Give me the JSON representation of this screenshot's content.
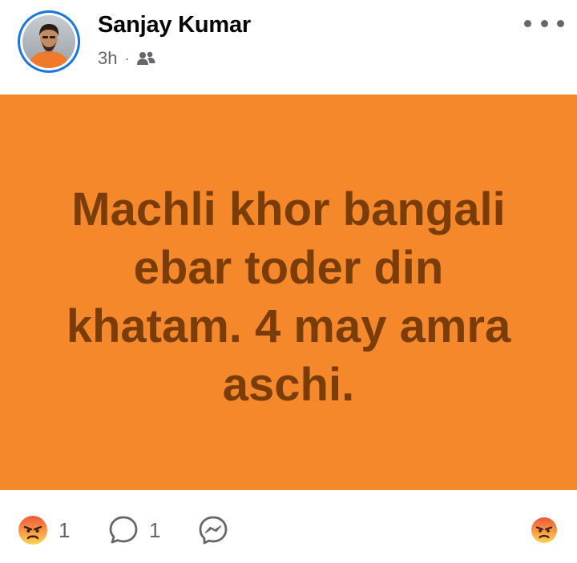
{
  "post": {
    "author": "Sanjay Kumar",
    "time": "3h",
    "separator": "·",
    "audience_icon": "friends-icon",
    "text": "Machli khor bangali ebar toder din khatam. 4 may amra aschi.",
    "background_color": "#f5882a",
    "text_color": "#7a3d08"
  },
  "footer": {
    "reaction": {
      "icon": "angry-reaction-icon",
      "count": "1"
    },
    "comments": {
      "icon": "comment-icon",
      "count": "1"
    },
    "share": {
      "icon": "messenger-icon"
    },
    "react_button": {
      "icon": "angry-reaction-icon"
    }
  },
  "colors": {
    "accent_ring": "#1b74e4",
    "muted": "#65676b",
    "angry_top": "#f0573a",
    "angry_bottom": "#fcd44e"
  }
}
